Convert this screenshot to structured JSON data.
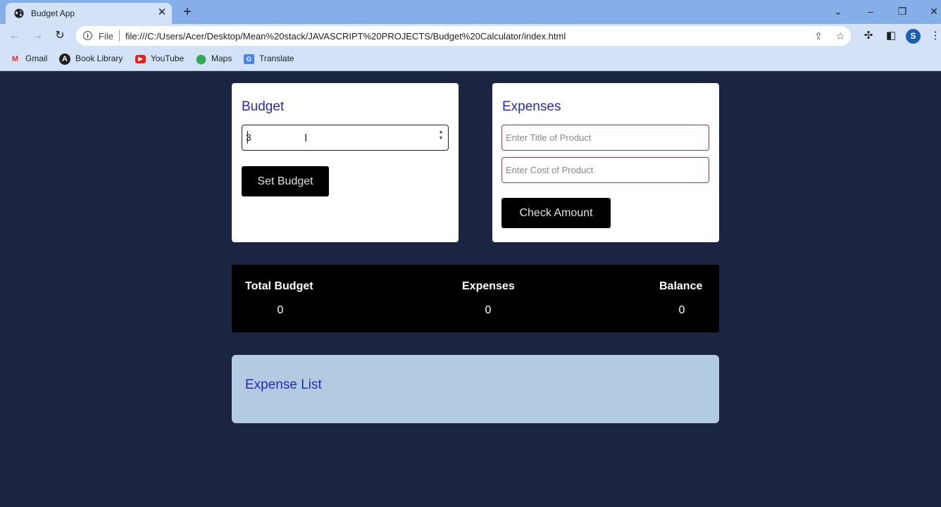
{
  "browser": {
    "tab_title": "Budget App",
    "url_scheme": "File",
    "url": "file:///C:/Users/Acer/Desktop/Mean%20stack/JAVASCRIPT%20PROJECTS/Budget%20Calculator/index.html",
    "profile_initial": "S",
    "bookmarks": [
      "Gmail",
      "Book Library",
      "YouTube",
      "Maps",
      "Translate"
    ]
  },
  "budget": {
    "title": "Budget",
    "input_value": "3",
    "button_label": "Set Budget"
  },
  "expenses": {
    "title": "Expenses",
    "product_title_placeholder": "Enter Title of Product",
    "product_cost_placeholder": "Enter Cost of Product",
    "button_label": "Check Amount"
  },
  "summary": {
    "total_budget_label": "Total Budget",
    "total_budget_value": "0",
    "expenses_label": "Expenses",
    "expenses_value": "0",
    "balance_label": "Balance",
    "balance_value": "0"
  },
  "expense_list": {
    "title": "Expense List"
  },
  "colors": {
    "page_background": "#1b2440",
    "card_title": "#2a29b0",
    "button_background": "#000000",
    "expense_list_background": "#b2cbe0",
    "input_error_border": "#a83a3a"
  }
}
